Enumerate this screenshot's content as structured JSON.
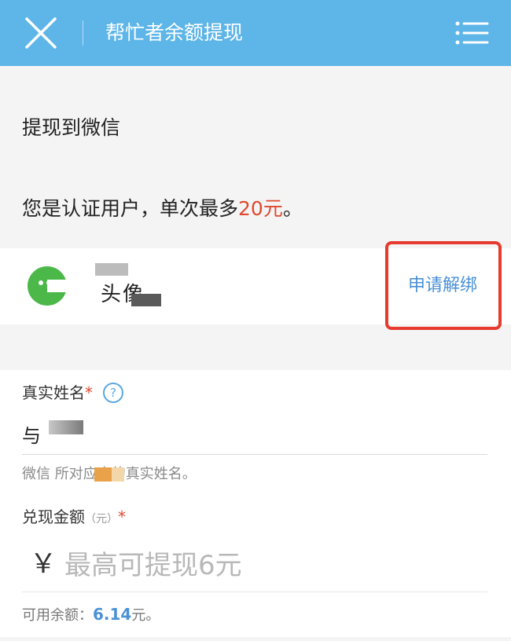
{
  "header": {
    "title": "帮忙者余额提现",
    "close_icon": "close-icon",
    "menu_icon": "menu-list-icon",
    "bg_color": "#5db5e8"
  },
  "withdraw": {
    "section_title": "提现到微信",
    "limit_prefix": "您是认证用户，单次最多",
    "limit_amount": "20元",
    "limit_suffix": "。"
  },
  "account": {
    "logo_icon": "wechat-logo-icon",
    "masked_line1": "微信",
    "masked_line2": "头像",
    "unbind_label": "申请解绑"
  },
  "form": {
    "name_label": "真实姓名",
    "required_mark": "*",
    "help_glyph": "?",
    "name_value": "与",
    "name_hint": "微信        所对应人的真实姓名。",
    "amount_label": "兑现金额",
    "amount_unit": "（元）",
    "currency_symbol": "￥",
    "amount_placeholder": "最高可提现6元",
    "balance_label": "可用余额：",
    "balance_value": "6.14",
    "balance_suffix": "元。"
  },
  "colors": {
    "accent_red": "#e0482f",
    "link_blue": "#4a90d6",
    "highlight_border": "#e63b2e"
  }
}
